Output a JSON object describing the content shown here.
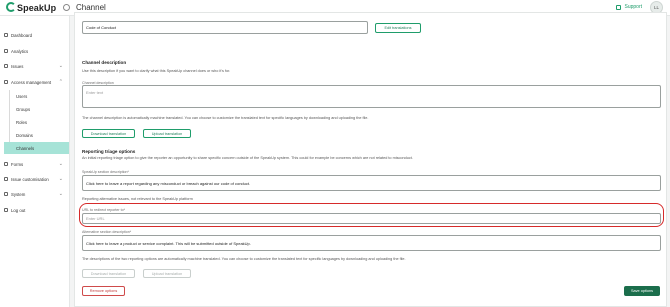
{
  "app": {
    "brand": "SpeakUp",
    "page_title": "Channel",
    "support_label": "Support",
    "user_initials": "LL"
  },
  "sidebar": {
    "items": [
      {
        "label": "Dashboard",
        "icon": "dashboard-icon"
      },
      {
        "label": "Analytics",
        "icon": "analytics-icon"
      },
      {
        "label": "Issues",
        "icon": "issues-icon",
        "expandable": true
      },
      {
        "label": "Access management",
        "icon": "access-icon",
        "expandable": true
      },
      {
        "label": "Forms",
        "icon": "forms-icon",
        "expandable": true
      },
      {
        "label": "Issue customisation",
        "icon": "customisation-icon",
        "expandable": true
      },
      {
        "label": "System",
        "icon": "system-icon",
        "expandable": true
      },
      {
        "label": "Log out",
        "icon": "logout-icon"
      }
    ],
    "sub_items": [
      "Users",
      "Groups",
      "Roles",
      "Domains",
      "Channels"
    ],
    "active_sub": "Channels"
  },
  "channel_name": {
    "value": "Code of Conduct",
    "edit_label": "Edit translations"
  },
  "channel_description": {
    "title": "Channel description",
    "help": "Use this description if you want to clarify what this SpeakUp channel does or who it's for.",
    "field_label": "Channel description",
    "placeholder": "Enter text",
    "note": "The channel description is automatically machine translated. You can choose to customize the translated text for specific languages by downloading and uploading the file.",
    "download_label": "Download translation",
    "upload_label": "Upload translation"
  },
  "triage": {
    "title": "Reporting triage options",
    "help": "An initial reporting triage option to give the reporter an opportunity to share specific concern outside of the SpeakUp system. This could for example be concerns which are not related to misconduct.",
    "section_label": "SpeakUp section description*",
    "section_value": "Click here to leave a report regarding any misconduct or breach against our code of conduct.",
    "alt_label": "Reporting alternative issues, not relevant to the SpeakUp platform",
    "url_label": "URL to redirect reporter to*",
    "url_placeholder": "Enter URL",
    "alt_desc_label": "Alternative section description*",
    "alt_desc_value": "Click here to leave a product or service complaint. This will be submitted outside of SpeakUp.",
    "download_label": "Download translation",
    "upload_label": "Upload translation",
    "note": "The descriptions of the two reporting options are automatically machine translated. You can choose to customize the translated text for specific languages by downloading and uploading the file.",
    "remove_label": "Remove options",
    "save_label": "Save options"
  },
  "colors": {
    "accent": "#1f9d6b",
    "active_nav": "#a6e3d7",
    "highlight": "#d62b2b",
    "primary_button": "#1b6e4c"
  }
}
